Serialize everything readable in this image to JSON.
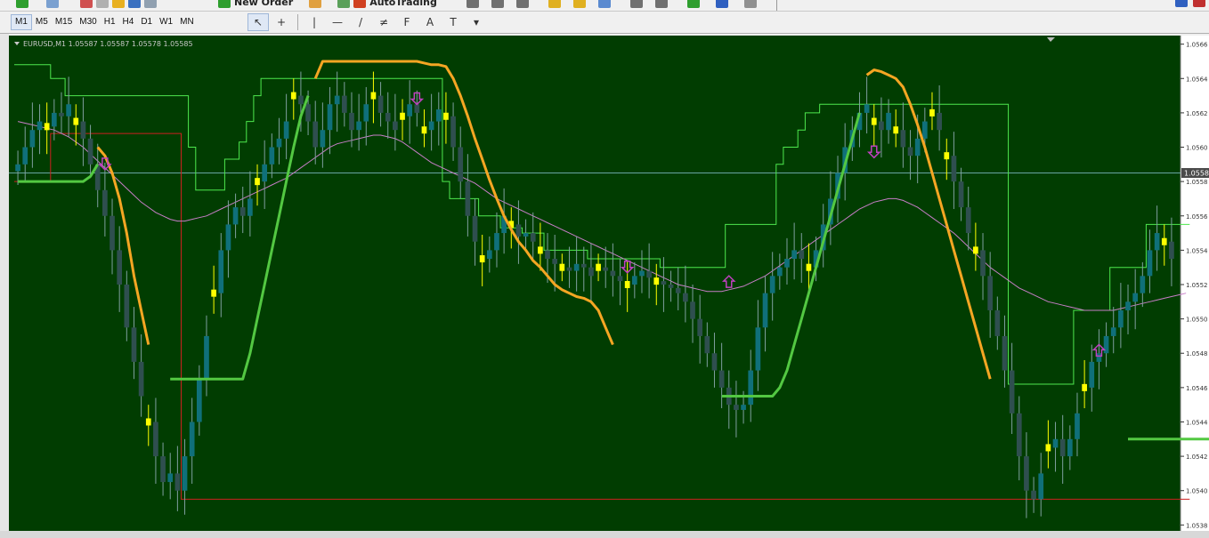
{
  "toolbar": {
    "new_order_label": "New Order",
    "auto_trading_label": "AutoTrading",
    "timeframes": [
      "M1",
      "M5",
      "M15",
      "M30",
      "H1",
      "H4",
      "D1",
      "W1",
      "MN"
    ],
    "active_timeframe": "M1",
    "drawing_tools": [
      {
        "name": "cursor-icon",
        "glyph": "↖",
        "active": true
      },
      {
        "name": "crosshair-icon",
        "glyph": "+",
        "active": false
      },
      {
        "name": "vertical-line-icon",
        "glyph": "|",
        "active": false
      },
      {
        "name": "horizontal-line-icon",
        "glyph": "—",
        "active": false
      },
      {
        "name": "trendline-icon",
        "glyph": "/",
        "active": false
      },
      {
        "name": "equidistant-channel-icon",
        "glyph": "≠",
        "active": false
      },
      {
        "name": "fibonacci-icon",
        "glyph": "F",
        "active": false
      },
      {
        "name": "text-icon",
        "glyph": "A",
        "active": false
      },
      {
        "name": "text-label-icon",
        "glyph": "T",
        "active": false
      },
      {
        "name": "shapes-icon",
        "glyph": "▾",
        "active": false
      }
    ]
  },
  "chart_data": {
    "type": "candlestick",
    "title": "EURUSD,M1  1.05587 1.05587 1.05578 1.05585",
    "symbol": "EURUSD",
    "timeframe": "M1",
    "ohlc": {
      "open": 1.05587,
      "high": 1.05587,
      "low": 1.05578,
      "close": 1.05585
    },
    "current_price": 1.05585,
    "current_price_label": "1.0558",
    "y_ticks": [
      "1.0566",
      "1.0564",
      "1.0562",
      "1.0560",
      "1.0558",
      "1.0556",
      "1.0554",
      "1.0552",
      "1.0550",
      "1.0548",
      "1.0546",
      "1.0544",
      "1.0542",
      "1.0540",
      "1.0538"
    ],
    "ylim": [
      1.05375,
      1.05665
    ],
    "grid": false,
    "colors": {
      "background": "#013d01",
      "bull_candle": "#10707a",
      "bear_candle": "#2f4f4f",
      "doji": "#ffff00",
      "orange_line": "#f5a623",
      "green_line": "#53c842",
      "upper_channel": "#4ee84e",
      "lower_channel": "#cc2020",
      "moving_average": "#c87ec8",
      "price_line": "#6aa4a4",
      "arrows": "#c040c0"
    },
    "n_bars": 160,
    "closes": [
      1.0559,
      1.056,
      1.0561,
      1.05615,
      1.05612,
      1.0562,
      1.05618,
      1.05625,
      1.05615,
      1.05605,
      1.0559,
      1.05575,
      1.0556,
      1.0554,
      1.0552,
      1.05495,
      1.05475,
      1.05455,
      1.0544,
      1.0542,
      1.05405,
      1.0541,
      1.054,
      1.0542,
      1.0544,
      1.05465,
      1.0549,
      1.05515,
      1.0554,
      1.05555,
      1.05565,
      1.0556,
      1.0557,
      1.0558,
      1.0559,
      1.056,
      1.05605,
      1.05615,
      1.0563,
      1.05625,
      1.05615,
      1.056,
      1.0561,
      1.05625,
      1.0563,
      1.0562,
      1.0561,
      1.05615,
      1.05625,
      1.0563,
      1.0562,
      1.05615,
      1.0561,
      1.05618,
      1.05625,
      1.0562,
      1.0561,
      1.05615,
      1.05622,
      1.05618,
      1.056,
      1.0558,
      1.0556,
      1.05545,
      1.05535,
      1.0554,
      1.0555,
      1.0556,
      1.05555,
      1.05548,
      1.0555,
      1.05545,
      1.0554,
      1.05535,
      1.05532,
      1.0553,
      1.05528,
      1.05532,
      1.0553,
      1.05525,
      1.0553,
      1.05528,
      1.05525,
      1.05522,
      1.0552,
      1.05525,
      1.05528,
      1.05524,
      1.05522,
      1.0552,
      1.05518,
      1.05515,
      1.0551,
      1.055,
      1.0549,
      1.0548,
      1.0547,
      1.0546,
      1.0545,
      1.05447,
      1.0545,
      1.0547,
      1.05495,
      1.05515,
      1.05525,
      1.0553,
      1.05535,
      1.0554,
      1.05535,
      1.0553,
      1.0554,
      1.05555,
      1.0557,
      1.05585,
      1.056,
      1.0561,
      1.0562,
      1.05625,
      1.05615,
      1.0561,
      1.0562,
      1.0561,
      1.056,
      1.05595,
      1.05605,
      1.05615,
      1.0562,
      1.0561,
      1.05595,
      1.0558,
      1.05565,
      1.0555,
      1.0554,
      1.05525,
      1.05505,
      1.0549,
      1.0547,
      1.05445,
      1.0542,
      1.054,
      1.05395,
      1.0541,
      1.05425,
      1.0543,
      1.0542,
      1.0543,
      1.05445,
      1.0546,
      1.05475,
      1.0548,
      1.0549,
      1.05495,
      1.05505,
      1.0551,
      1.05515,
      1.05525,
      1.0554,
      1.0555,
      1.05545,
      1.05535
    ],
    "doji_bars": [
      4,
      8,
      18,
      27,
      33,
      38,
      49,
      53,
      56,
      59,
      64,
      68,
      72,
      75,
      80,
      84,
      88,
      109,
      118,
      121,
      126,
      128,
      132,
      142,
      147,
      158
    ],
    "arrows_down": [
      {
        "bar": 12,
        "price": 1.0559
      },
      {
        "bar": 55,
        "price": 1.05628
      },
      {
        "bar": 84,
        "price": 1.0553
      },
      {
        "bar": 118,
        "price": 1.05597
      }
    ],
    "arrows_up": [
      {
        "bar": 98,
        "price": 1.05522
      },
      {
        "bar": 149,
        "price": 1.05482
      }
    ],
    "upper_channel": [
      1.05648,
      1.05648,
      1.05648,
      1.05648,
      1.05648,
      1.0564,
      1.0564,
      1.0563,
      1.0563,
      1.0563,
      1.0563,
      1.0563,
      1.0563,
      1.0563,
      1.0563,
      1.0563,
      1.0563,
      1.0563,
      1.0563,
      1.0563,
      1.0563,
      1.0563,
      1.0563,
      1.0563,
      1.056,
      1.05575,
      1.05575,
      1.05575,
      1.05575,
      1.05593,
      1.05593,
      1.05603,
      1.05615,
      1.0563,
      1.0564,
      1.0564,
      1.0564,
      1.0564,
      1.0564,
      1.0564,
      1.0564,
      1.0564,
      1.0564,
      1.0564,
      1.0564,
      1.0564,
      1.0564,
      1.0564,
      1.0564,
      1.0564,
      1.0564,
      1.0564,
      1.0564,
      1.0564,
      1.0564,
      1.0564,
      1.0564,
      1.0564,
      1.0564,
      1.0558,
      1.0557,
      1.0557,
      1.0557,
      1.0557,
      1.0556,
      1.0556,
      1.0556,
      1.05553,
      1.05553,
      1.05553,
      1.0555,
      1.0555,
      1.0555,
      1.0554,
      1.0554,
      1.0554,
      1.0554,
      1.0554,
      1.0554,
      1.05535,
      1.05535,
      1.05535,
      1.05535,
      1.05535,
      1.05535,
      1.05535,
      1.05535,
      1.05535,
      1.05535,
      1.0553,
      1.0553,
      1.0553,
      1.0553,
      1.0553,
      1.0553,
      1.0553,
      1.0553,
      1.0553,
      1.05555,
      1.05555,
      1.05555,
      1.05555,
      1.05555,
      1.05555,
      1.05555,
      1.0559,
      1.056,
      1.056,
      1.0561,
      1.0562,
      1.0562,
      1.05625,
      1.05625,
      1.05625,
      1.05625,
      1.05625,
      1.05625,
      1.05625,
      1.05625,
      1.05625,
      1.05625,
      1.05625,
      1.05625,
      1.05625,
      1.05625,
      1.05625,
      1.05625,
      1.05625,
      1.05625,
      1.05625,
      1.05625,
      1.05625,
      1.05625,
      1.05625,
      1.05625,
      1.05625,
      1.05625,
      1.05462,
      1.05462,
      1.05462,
      1.05462,
      1.05462,
      1.05462,
      1.05462,
      1.05462,
      1.05462,
      1.05505,
      1.05505,
      1.05505,
      1.05505,
      1.05505,
      1.0553,
      1.0553,
      1.0553,
      1.0553,
      1.0553,
      1.05555,
      1.05555,
      1.05555,
      1.05555,
      1.05555,
      1.05555
    ],
    "lower_channel": [
      1.0558,
      1.0558,
      1.0558,
      1.0558,
      1.0558,
      1.05608,
      1.05608,
      1.05608,
      1.05608,
      1.05608,
      1.05608,
      1.05608,
      1.05608,
      1.05608,
      1.05608,
      1.05608,
      1.05608,
      1.05608,
      1.05608,
      1.05608,
      1.05608,
      1.05608,
      1.05608,
      1.05395,
      1.05395,
      1.05395,
      1.05395,
      1.05395,
      1.05395,
      1.05395,
      1.05395,
      1.05395,
      1.05395,
      1.05395,
      1.05395,
      1.05395,
      1.05395,
      1.05395,
      1.05395,
      1.05395,
      1.05395,
      1.05395,
      1.05395,
      1.05395,
      1.05395,
      1.05395,
      1.05395,
      1.05395,
      1.05395,
      1.05395,
      1.05395,
      1.05395,
      1.05395,
      1.05395,
      1.05395,
      1.05395,
      1.05395,
      1.05395,
      1.05395,
      1.05395,
      1.05395,
      1.05395,
      1.05395,
      1.05395,
      1.05395,
      1.05395,
      1.05395,
      1.05395,
      1.05395,
      1.05395,
      1.05395,
      1.05395,
      1.05395,
      1.05395,
      1.05395,
      1.05395,
      1.05395,
      1.05395,
      1.05395,
      1.05395,
      1.05395,
      1.05395,
      1.05395,
      1.05395,
      1.05395,
      1.05395,
      1.05395,
      1.05395,
      1.05395,
      1.05395,
      1.05395,
      1.05395,
      1.05395,
      1.05395,
      1.05395,
      1.05395,
      1.05395,
      1.05395,
      1.05395,
      1.05395,
      1.05395,
      1.05395,
      1.05395,
      1.05395,
      1.05395,
      1.05395,
      1.05395,
      1.05395,
      1.05395,
      1.05395,
      1.05395,
      1.05395,
      1.05395,
      1.05395,
      1.05395,
      1.05395,
      1.05395,
      1.05395,
      1.05395,
      1.05395,
      1.05395,
      1.05395,
      1.05395,
      1.05395,
      1.05395,
      1.05395,
      1.05395,
      1.05395,
      1.05395,
      1.05395,
      1.05395,
      1.05395,
      1.05395,
      1.05395,
      1.05395,
      1.05395,
      1.05395,
      1.05395,
      1.05395,
      1.05395,
      1.05395,
      1.05395,
      1.05395,
      1.05395,
      1.05395,
      1.05395,
      1.05395,
      1.05395,
      1.05395,
      1.05395,
      1.05395,
      1.05395,
      1.05395,
      1.05395,
      1.05395,
      1.05395,
      1.05395,
      1.05395,
      1.05395,
      1.05395,
      1.05395,
      1.05395
    ],
    "orange_line": [
      null,
      null,
      null,
      null,
      null,
      null,
      null,
      null,
      null,
      null,
      null,
      1.056,
      1.05595,
      1.05585,
      1.0557,
      1.0555,
      1.05525,
      1.05505,
      1.05485,
      null,
      null,
      null,
      null,
      null,
      null,
      null,
      null,
      null,
      null,
      null,
      null,
      null,
      null,
      null,
      null,
      null,
      null,
      null,
      null,
      null,
      null,
      1.0564,
      1.0565,
      1.0565,
      1.0565,
      1.0565,
      1.0565,
      1.0565,
      1.0565,
      1.0565,
      1.0565,
      1.0565,
      1.0565,
      1.0565,
      1.0565,
      1.0565,
      1.05649,
      1.05648,
      1.05648,
      1.05647,
      1.0564,
      1.0563,
      1.05618,
      1.05605,
      1.05593,
      1.05581,
      1.0557,
      1.0556,
      1.05552,
      1.05545,
      1.0554,
      1.05534,
      1.0553,
      1.05525,
      1.0552,
      1.05517,
      1.05515,
      1.05513,
      1.05512,
      1.0551,
      1.05505,
      1.05495,
      1.05485,
      null,
      null,
      null,
      null,
      null,
      null,
      null,
      null,
      null,
      null,
      null,
      null,
      null,
      null,
      null,
      null,
      null,
      null,
      null,
      null,
      null,
      null,
      null,
      null,
      null,
      null,
      null,
      null,
      null,
      null,
      null,
      null,
      null,
      null,
      1.05642,
      1.05645,
      1.05644,
      1.05642,
      1.0564,
      1.05635,
      1.05625,
      1.05613,
      1.056,
      1.05585,
      1.0557,
      1.05555,
      1.0554,
      1.05525,
      1.0551,
      1.05495,
      1.0548,
      1.05465,
      null,
      null,
      null,
      null,
      null,
      null,
      null,
      null,
      null,
      null,
      null,
      null,
      null,
      null,
      null,
      null,
      null,
      null,
      null,
      null,
      null,
      null,
      null,
      null
    ],
    "green_line": [
      1.0558,
      1.0558,
      1.0558,
      1.0558,
      1.0558,
      1.0558,
      1.0558,
      1.0558,
      1.0558,
      1.0558,
      1.05583,
      1.0559,
      null,
      null,
      null,
      null,
      null,
      null,
      null,
      null,
      null,
      1.05465,
      1.05465,
      1.05465,
      1.05465,
      1.05465,
      1.05465,
      1.05465,
      1.05465,
      1.05465,
      1.05465,
      1.05465,
      1.0548,
      1.055,
      1.0552,
      1.0554,
      1.0556,
      1.0558,
      1.056,
      1.05618,
      1.0563,
      null,
      null,
      null,
      null,
      null,
      null,
      null,
      null,
      null,
      null,
      null,
      null,
      null,
      null,
      null,
      null,
      null,
      null,
      null,
      null,
      null,
      null,
      null,
      null,
      null,
      null,
      null,
      null,
      null,
      null,
      null,
      null,
      null,
      null,
      null,
      null,
      null,
      null,
      null,
      null,
      null,
      null,
      null,
      null,
      null,
      null,
      null,
      null,
      null,
      null,
      null,
      null,
      null,
      null,
      null,
      null,
      1.05455,
      1.05455,
      1.05455,
      1.05455,
      1.05455,
      1.05455,
      1.05455,
      1.05455,
      1.0546,
      1.0547,
      1.05485,
      1.055,
      1.05515,
      1.0553,
      1.05545,
      1.0556,
      1.05575,
      1.0559,
      1.05605,
      1.0562,
      null,
      null,
      null,
      null,
      null,
      null,
      null,
      null,
      null,
      null,
      null,
      null,
      null,
      null,
      null,
      null,
      null,
      null,
      null,
      null,
      null,
      null,
      null,
      null,
      null,
      null,
      null,
      null,
      null,
      null,
      null,
      null,
      null,
      null,
      null,
      null,
      1.0543,
      1.0543,
      1.0543,
      1.0543,
      1.0543,
      1.0543,
      1.0543,
      1.0543,
      1.0543,
      1.0543,
      1.0543,
      1.0543,
      1.0543,
      1.0543,
      1.0543,
      1.0543,
      1.0543,
      1.0543,
      1.0543,
      1.0543,
      1.0543,
      1.0543,
      1.0543,
      1.05445,
      1.05465
    ],
    "moving_average": [
      1.05615,
      1.05614,
      1.05613,
      1.05612,
      1.05611,
      1.0561,
      1.05608,
      1.05606,
      1.05603,
      1.056,
      1.05596,
      1.05592,
      1.05588,
      1.05584,
      1.0558,
      1.05576,
      1.05572,
      1.05568,
      1.05565,
      1.05562,
      1.0556,
      1.05558,
      1.05557,
      1.05557,
      1.05558,
      1.05559,
      1.0556,
      1.05562,
      1.05564,
      1.05566,
      1.05568,
      1.0557,
      1.05572,
      1.05574,
      1.05576,
      1.05578,
      1.0558,
      1.05582,
      1.05585,
      1.05588,
      1.05591,
      1.05594,
      1.05597,
      1.056,
      1.05602,
      1.05603,
      1.05604,
      1.05605,
      1.05606,
      1.05607,
      1.05607,
      1.05606,
      1.05605,
      1.05603,
      1.056,
      1.05597,
      1.05594,
      1.05591,
      1.05589,
      1.05587,
      1.05585,
      1.05583,
      1.05581,
      1.05579,
      1.05576,
      1.05573,
      1.0557,
      1.05568,
      1.05566,
      1.05564,
      1.05562,
      1.0556,
      1.05558,
      1.05556,
      1.05554,
      1.05552,
      1.0555,
      1.05548,
      1.05546,
      1.05544,
      1.05542,
      1.0554,
      1.05538,
      1.05536,
      1.05534,
      1.05532,
      1.0553,
      1.05528,
      1.05526,
      1.05524,
      1.05522,
      1.0552,
      1.05519,
      1.05518,
      1.05517,
      1.05516,
      1.05516,
      1.05516,
      1.05517,
      1.05518,
      1.05519,
      1.05521,
      1.05523,
      1.05525,
      1.05528,
      1.05531,
      1.05534,
      1.05537,
      1.0554,
      1.05543,
      1.05546,
      1.05549,
      1.05552,
      1.05555,
      1.05558,
      1.05561,
      1.05564,
      1.05566,
      1.05568,
      1.05569,
      1.0557,
      1.0557,
      1.05569,
      1.05567,
      1.05565,
      1.05562,
      1.05559,
      1.05556,
      1.05553,
      1.0555,
      1.05546,
      1.05542,
      1.05538,
      1.05534,
      1.0553,
      1.05527,
      1.05524,
      1.05521,
      1.05518,
      1.05516,
      1.05514,
      1.05512,
      1.0551,
      1.05509,
      1.05508,
      1.05507,
      1.05506,
      1.05505,
      1.05505,
      1.05505,
      1.05505,
      1.05505,
      1.05506,
      1.05507,
      1.05508,
      1.05509,
      1.0551,
      1.05511,
      1.05512,
      1.05513,
      1.05514,
      1.05515
    ]
  }
}
